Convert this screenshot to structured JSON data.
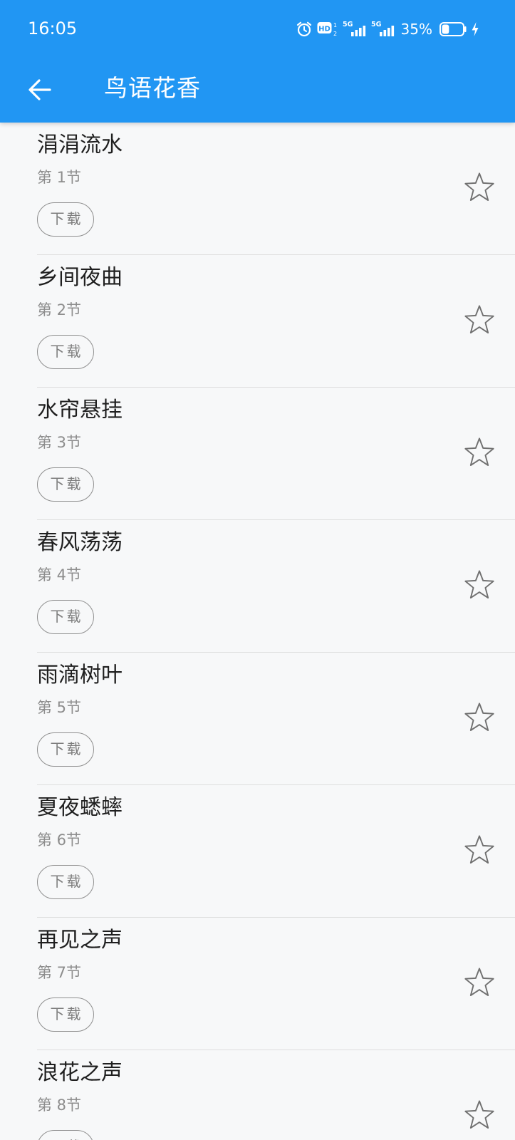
{
  "status_bar": {
    "time": "16:05",
    "battery_percent": "35%",
    "network_1": "5G",
    "network_2": "5G",
    "hd_label": "HD",
    "battery_level": 0.35,
    "icons": [
      "alarm-icon",
      "hd-icon",
      "signal-icon",
      "signal-icon",
      "battery-icon",
      "charging-icon"
    ]
  },
  "header": {
    "title": "鸟语花香",
    "back_icon": "arrow-left-icon"
  },
  "colors": {
    "accent": "#2196f3",
    "background": "#f7f8f9",
    "title_text": "#1f1f1f",
    "subtitle_text": "#8d8d8d",
    "divider": "#dedede"
  },
  "list": {
    "items": [
      {
        "title": "涓涓流水",
        "subtitle": "第 1节",
        "download_label": "下载",
        "star_icon": "star-outline-icon"
      },
      {
        "title": "乡间夜曲",
        "subtitle": "第 2节",
        "download_label": "下载",
        "star_icon": "star-outline-icon"
      },
      {
        "title": "水帘悬挂",
        "subtitle": "第 3节",
        "download_label": "下载",
        "star_icon": "star-outline-icon"
      },
      {
        "title": "春风荡荡",
        "subtitle": "第 4节",
        "download_label": "下载",
        "star_icon": "star-outline-icon"
      },
      {
        "title": "雨滴树叶",
        "subtitle": "第 5节",
        "download_label": "下载",
        "star_icon": "star-outline-icon"
      },
      {
        "title": "夏夜蟋蟀",
        "subtitle": "第 6节",
        "download_label": "下载",
        "star_icon": "star-outline-icon"
      },
      {
        "title": "再见之声",
        "subtitle": "第 7节",
        "download_label": "下载",
        "star_icon": "star-outline-icon"
      },
      {
        "title": "浪花之声",
        "subtitle": "第 8节",
        "download_label": "下载",
        "star_icon": "star-outline-icon"
      }
    ]
  }
}
